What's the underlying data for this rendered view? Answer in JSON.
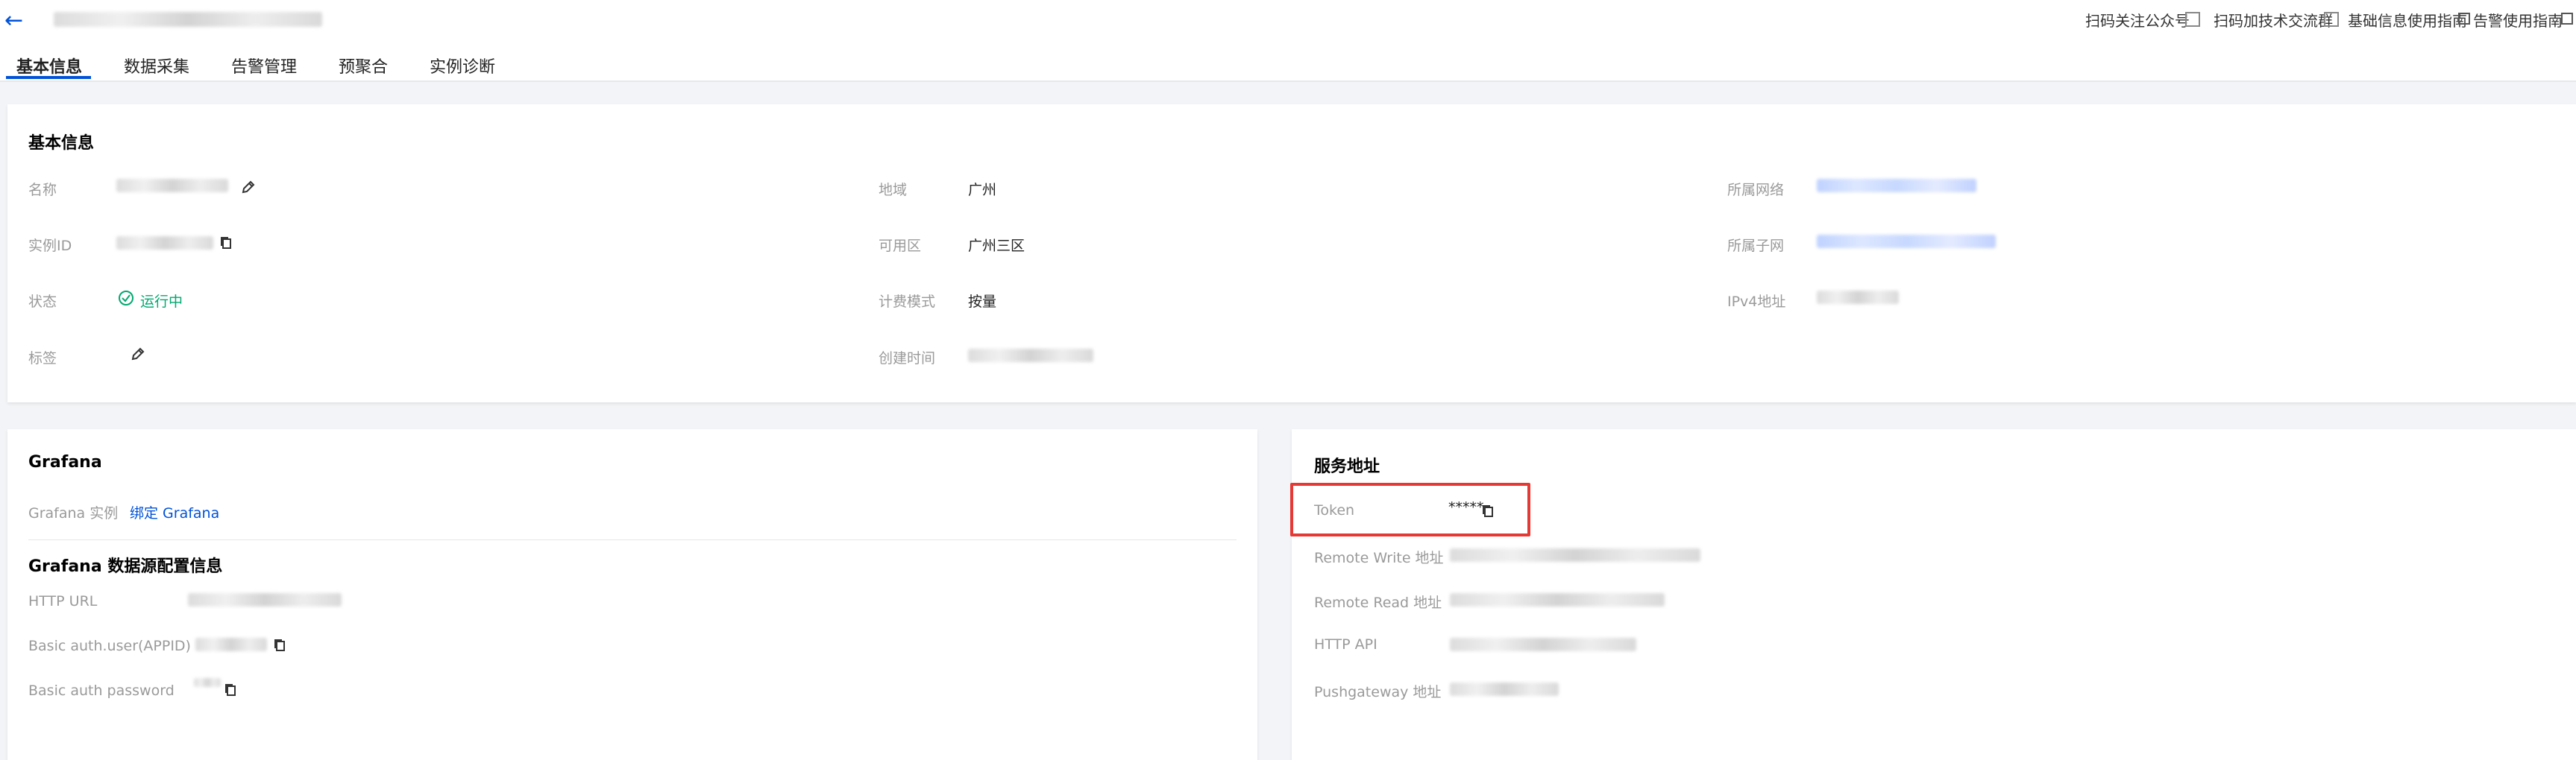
{
  "top_links": [
    "扫码关注公众号",
    "扫码加技术交流群",
    "基础信息使用指南",
    "告警使用指南"
  ],
  "tabs": [
    "基本信息",
    "数据采集",
    "告警管理",
    "预聚合",
    "实例诊断"
  ],
  "basic": {
    "title": "基本信息",
    "name_label": "名称",
    "instance_id_label": "实例ID",
    "status_label": "状态",
    "status_value": "运行中",
    "tags_label": "标签",
    "region_label": "地域",
    "region_value": "广州",
    "zone_label": "可用区",
    "zone_value": "广州三区",
    "billing_label": "计费模式",
    "billing_value": "按量",
    "created_label": "创建时间",
    "vpc_label": "所属网络",
    "subnet_label": "所属子网",
    "ipv4_label": "IPv4地址"
  },
  "grafana": {
    "title": "Grafana",
    "instance_label": "Grafana 实例",
    "bind_link": "绑定 Grafana",
    "ds_title": "Grafana 数据源配置信息",
    "http_url_label": "HTTP URL",
    "user_label": "Basic auth.user(APPID)",
    "password_label": "Basic auth password"
  },
  "service": {
    "title": "服务地址",
    "token_label": "Token",
    "token_value": "*****",
    "remote_write_label": "Remote Write 地址",
    "remote_read_label": "Remote Read 地址",
    "http_api_label": "HTTP API",
    "pushgateway_label": "Pushgateway 地址"
  },
  "colors": {
    "accent": "#0052d9",
    "success": "#00a870",
    "highlight": "#e53935"
  }
}
